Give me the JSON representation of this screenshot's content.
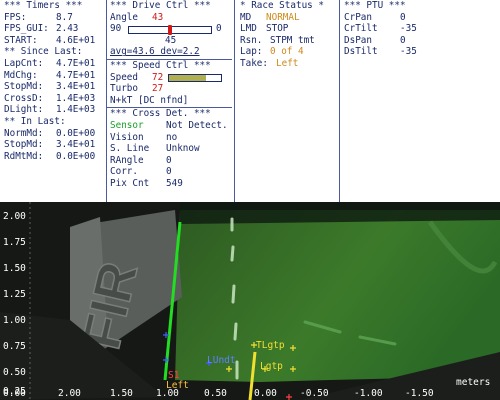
{
  "timers": {
    "header": "*** Timers ***",
    "rows": [
      {
        "label": "FPS:",
        "value": "8.7"
      },
      {
        "label": "FPS_GUI:",
        "value": "2.43"
      },
      {
        "label": "START:",
        "value": "4.6E+01"
      }
    ],
    "since_header": "** Since Last:",
    "since_rows": [
      {
        "label": "LapCnt:",
        "value": "4.7E+01"
      },
      {
        "label": "MdChg:",
        "value": "4.7E+01"
      },
      {
        "label": "StopMd:",
        "value": "3.4E+01"
      },
      {
        "label": "CrossD:",
        "value": "1.4E+03"
      },
      {
        "label": "DLight:",
        "value": "1.4E+03"
      }
    ],
    "in_header": "** In Last:",
    "in_rows": [
      {
        "label": "NormMd:",
        "value": "0.0E+00"
      },
      {
        "label": "StopMd:",
        "value": "3.4E+01"
      },
      {
        "label": "RdMtMd:",
        "value": "0.0E+00"
      }
    ]
  },
  "drive": {
    "header": "*** Drive Ctrl ***",
    "angle_label": "Angle",
    "angle_value": "43",
    "slider_min": "90",
    "slider_max": "0",
    "slider_level": 0.5,
    "slider_mid": "45",
    "avg_dev": "avg=43.6 dev=2.2",
    "speed_header": "*** Speed Ctrl ***",
    "speed_label": "Speed",
    "speed_value": "72",
    "speed_level": 0.72,
    "turbo_label": "Turbo",
    "turbo_value": "27",
    "nkt": "N+kT [DC nfnd]",
    "cross_header": "*** Cross Det. ***",
    "cross_rows": [
      {
        "label": "Sensor",
        "value": "Not Detect."
      },
      {
        "label": "Vision",
        "value": "no"
      },
      {
        "label": "S. Line",
        "value": "Unknow"
      },
      {
        "label": "RAngle",
        "value": "0"
      },
      {
        "label": "Corr.",
        "value": "0"
      },
      {
        "label": "Pix Cnt",
        "value": "549"
      }
    ]
  },
  "race": {
    "header": "* Race Status *",
    "rows": [
      {
        "label": "MD",
        "value": "NORMAL"
      },
      {
        "label": "LMD",
        "value": "STOP"
      },
      {
        "label": "Rsn.",
        "value": "STPM tmt"
      },
      {
        "label": "Lap:",
        "value": "0 of 4"
      },
      {
        "label": "Take:",
        "value": "Left"
      }
    ]
  },
  "ptu": {
    "header": "*** PTU ***",
    "rows": [
      {
        "label": "CrPan",
        "value": "0"
      },
      {
        "label": "CrTilt",
        "value": "-35"
      },
      {
        "label": "DsPan",
        "value": "0"
      },
      {
        "label": "DsTilt",
        "value": "-35"
      }
    ]
  },
  "camera": {
    "y_ticks": [
      "2.00",
      "1.75",
      "1.50",
      "1.25",
      "1.00",
      "0.75",
      "0.50",
      "0.25",
      "0.00"
    ],
    "x_ticks": [
      "2.00",
      "1.50",
      "1.00",
      "0.50",
      "0.00",
      "-0.50",
      "-1.00",
      "-1.50"
    ],
    "unit": "meters",
    "labels": {
      "tlgtp": "TLgtp",
      "lgtp": "Lgtp",
      "lundt": "LUndt",
      "s1": "S1",
      "left": "Left"
    }
  },
  "colors": {
    "panel_text": "#1a2a6a",
    "alert_red": "#d01818",
    "status_orange": "#d08a1a",
    "sensor_green": "#1aa02a",
    "track_green": "#3c7a2a",
    "guide_line": "#22dd22",
    "target_yellow": "#f0e030"
  }
}
